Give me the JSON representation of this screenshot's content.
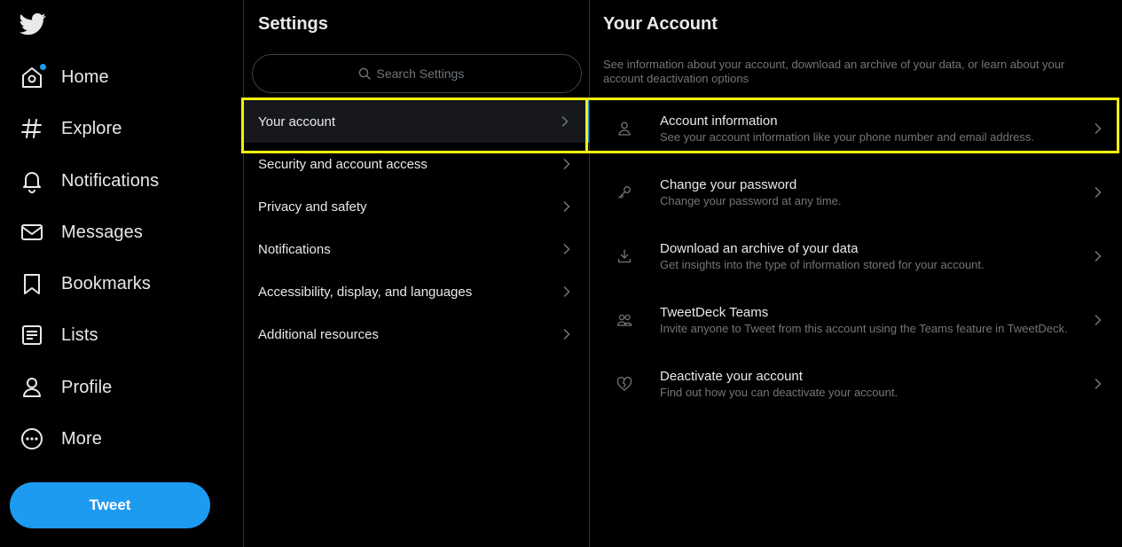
{
  "nav": {
    "items": [
      {
        "label": "Home",
        "icon": "home-icon"
      },
      {
        "label": "Explore",
        "icon": "hashtag-icon"
      },
      {
        "label": "Notifications",
        "icon": "bell-icon"
      },
      {
        "label": "Messages",
        "icon": "envelope-icon"
      },
      {
        "label": "Bookmarks",
        "icon": "bookmark-icon"
      },
      {
        "label": "Lists",
        "icon": "list-icon"
      },
      {
        "label": "Profile",
        "icon": "person-icon"
      },
      {
        "label": "More",
        "icon": "more-circle-icon"
      }
    ],
    "tweet_label": "Tweet"
  },
  "settings": {
    "title": "Settings",
    "search_placeholder": "Search Settings",
    "items": [
      {
        "label": "Your account"
      },
      {
        "label": "Security and account access"
      },
      {
        "label": "Privacy and safety"
      },
      {
        "label": "Notifications"
      },
      {
        "label": "Accessibility, display, and languages"
      },
      {
        "label": "Additional resources"
      }
    ]
  },
  "account": {
    "title": "Your Account",
    "description": "See information about your account, download an archive of your data, or learn about your account deactivation options",
    "items": [
      {
        "label": "Account information",
        "sub": "See your account information like your phone number and email address.",
        "icon": "person-outline-icon"
      },
      {
        "label": "Change your password",
        "sub": "Change your password at any time.",
        "icon": "key-icon"
      },
      {
        "label": "Download an archive of your data",
        "sub": "Get insights into the type of information stored for your account.",
        "icon": "download-icon"
      },
      {
        "label": "TweetDeck Teams",
        "sub": "Invite anyone to Tweet from this account using the Teams feature in TweetDeck.",
        "icon": "people-icon"
      },
      {
        "label": "Deactivate your account",
        "sub": "Find out how you can deactivate your account.",
        "icon": "broken-heart-icon"
      }
    ]
  },
  "colors": {
    "accent": "#1d9bf0",
    "highlight": "#f2f20f",
    "muted_text": "#71767b"
  }
}
